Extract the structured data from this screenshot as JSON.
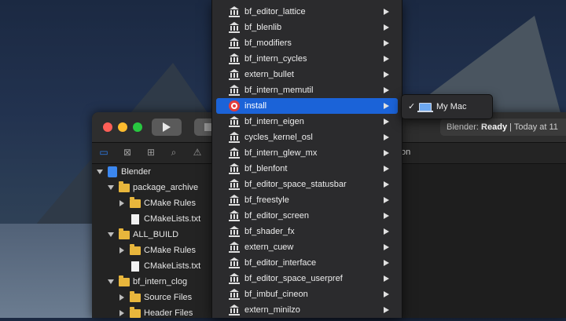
{
  "window": {
    "status_app": "Blender:",
    "status_state": "Ready",
    "status_time": "| Today at 11",
    "editor_bar_text": "ction"
  },
  "navigator": {
    "icons": [
      "folder-icon",
      "x-square-icon",
      "hierarchy-icon",
      "search-icon",
      "warning-icon"
    ]
  },
  "tree": [
    {
      "label": "Blender",
      "kind": "project",
      "disclosure": "open",
      "indent": 0
    },
    {
      "label": "package_archive",
      "kind": "folder",
      "disclosure": "open",
      "indent": 1
    },
    {
      "label": "CMake Rules",
      "kind": "folder",
      "disclosure": "closed",
      "indent": 2
    },
    {
      "label": "CMakeLists.txt",
      "kind": "file",
      "disclosure": "none",
      "indent": 2
    },
    {
      "label": "ALL_BUILD",
      "kind": "folder",
      "disclosure": "open",
      "indent": 1
    },
    {
      "label": "CMake Rules",
      "kind": "folder",
      "disclosure": "closed",
      "indent": 2
    },
    {
      "label": "CMakeLists.txt",
      "kind": "file",
      "disclosure": "none",
      "indent": 2
    },
    {
      "label": "bf_intern_clog",
      "kind": "folder",
      "disclosure": "open",
      "indent": 1
    },
    {
      "label": "Source Files",
      "kind": "folder",
      "disclosure": "closed",
      "indent": 2
    },
    {
      "label": "Header Files",
      "kind": "folder",
      "disclosure": "closed",
      "indent": 2
    }
  ],
  "menu_items": [
    {
      "label": "bf_editor_lattice",
      "icon": "library-icon"
    },
    {
      "label": "bf_blenlib",
      "icon": "library-icon"
    },
    {
      "label": "bf_modifiers",
      "icon": "library-icon"
    },
    {
      "label": "bf_intern_cycles",
      "icon": "library-icon"
    },
    {
      "label": "extern_bullet",
      "icon": "library-icon"
    },
    {
      "label": "bf_intern_memutil",
      "icon": "library-icon"
    },
    {
      "label": "install",
      "icon": "target-icon",
      "selected": true
    },
    {
      "label": "bf_intern_eigen",
      "icon": "library-icon"
    },
    {
      "label": "cycles_kernel_osl",
      "icon": "library-icon"
    },
    {
      "label": "bf_intern_glew_mx",
      "icon": "library-icon"
    },
    {
      "label": "bf_blenfont",
      "icon": "library-icon"
    },
    {
      "label": "bf_editor_space_statusbar",
      "icon": "library-icon"
    },
    {
      "label": "bf_freestyle",
      "icon": "library-icon"
    },
    {
      "label": "bf_editor_screen",
      "icon": "library-icon"
    },
    {
      "label": "bf_shader_fx",
      "icon": "library-icon"
    },
    {
      "label": "extern_cuew",
      "icon": "library-icon"
    },
    {
      "label": "bf_editor_interface",
      "icon": "library-icon"
    },
    {
      "label": "bf_editor_space_userpref",
      "icon": "library-icon"
    },
    {
      "label": "bf_imbuf_cineon",
      "icon": "library-icon"
    },
    {
      "label": "extern_minilzo",
      "icon": "library-icon"
    }
  ],
  "submenu": {
    "check": "✓",
    "label": "My Mac"
  },
  "colors": {
    "selection": "#1b63d8",
    "folder": "#e8b63c",
    "accent": "#2f7ff0"
  }
}
